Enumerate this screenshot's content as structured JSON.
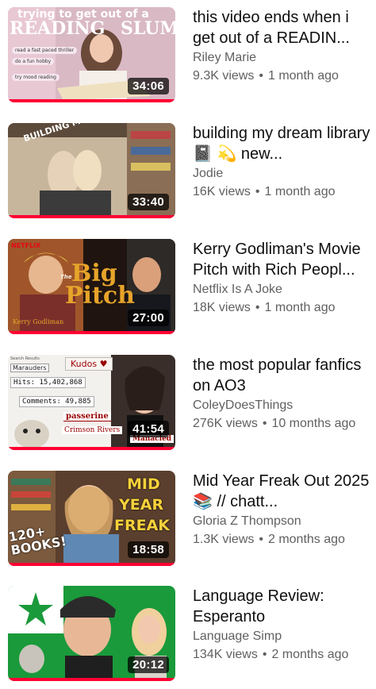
{
  "videos": [
    {
      "title": "this video ends when i get out of a READIN...",
      "channel": "Riley Marie",
      "views": "9.3K views",
      "age": "1 month ago",
      "duration": "34:06",
      "thumb_text": {
        "top": "trying to get out of a",
        "left": "READING",
        "right": "SLUMP",
        "chip1": "read a fast paced thriller",
        "chip2": "do a fun hobby",
        "chip3": "try mood reading"
      }
    },
    {
      "title": "building my dream library 📓 💫 new...",
      "channel": "Jodie",
      "views": "16K views",
      "age": "1 month ago",
      "duration": "33:40",
      "thumb_text": {
        "arc": "BUILDING MY DREAM LIBRARY"
      }
    },
    {
      "title": "Kerry Godliman's Movie Pitch with Rich Peopl...",
      "channel": "Netflix Is A Joke",
      "views": "18K views",
      "age": "1 month ago",
      "duration": "27:00",
      "thumb_text": {
        "brand": "NETFLIX",
        "big": "Big",
        "pitch": "Pitch",
        "name": "Kerry Godliman",
        "the": "The"
      }
    },
    {
      "title": "the most popular fanfics on AO3",
      "channel": "ColeyDoesThings",
      "views": "276K views",
      "age": "10 months ago",
      "duration": "41:54",
      "thumb_text": {
        "search": "Search Results",
        "marauders": "Marauders",
        "kudos": "Kudos ♥",
        "hits": "Hits: 15,402,868",
        "comments": "Comments: 49,885",
        "passerine": "passerine",
        "crimson": "Crimson Rivers",
        "manacled": "Manacled"
      }
    },
    {
      "title": "Mid Year Freak Out 2025 📚 // chatt...",
      "channel": "Gloria Z Thompson",
      "views": "1.3K views",
      "age": "2 months ago",
      "duration": "18:58",
      "thumb_text": {
        "mid": "MID",
        "year": "YEAR",
        "freak": "FREAK",
        "books": "120+ BOOKS!"
      }
    },
    {
      "title": "Language Review: Esperanto",
      "channel": "Language Simp",
      "views": "134K views",
      "age": "2 months ago",
      "duration": "20:12",
      "thumb_text": {}
    }
  ],
  "colors": {
    "progress": "#ff0033",
    "secondary_text": "#606060",
    "primary_text": "#0f0f0f"
  }
}
